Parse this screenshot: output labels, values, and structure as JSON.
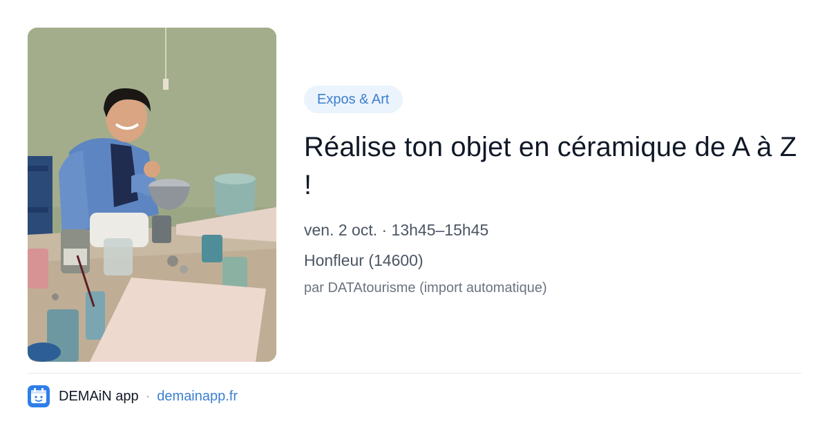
{
  "event": {
    "category": "Expos & Art",
    "title": "Réalise ton objet en céramique de A à Z !",
    "datetime": "ven. 2 oct. · 13h45–15h45",
    "location": "Honfleur (14600)",
    "source": "par DATAtourisme (import automatique)"
  },
  "footer": {
    "app_name": "DEMAiN app",
    "separator": "·",
    "link": "demainapp.fr",
    "icon": "demain-app-icon"
  },
  "photo": {
    "icon": "event-photo-pottery-workshop"
  },
  "colors": {
    "tag_background": "#ebf3fc",
    "accent": "#3b7fcf",
    "title": "#111827",
    "secondary_text": "#4b5563",
    "muted_text": "#6b7280",
    "divider": "#e2e8ee"
  }
}
